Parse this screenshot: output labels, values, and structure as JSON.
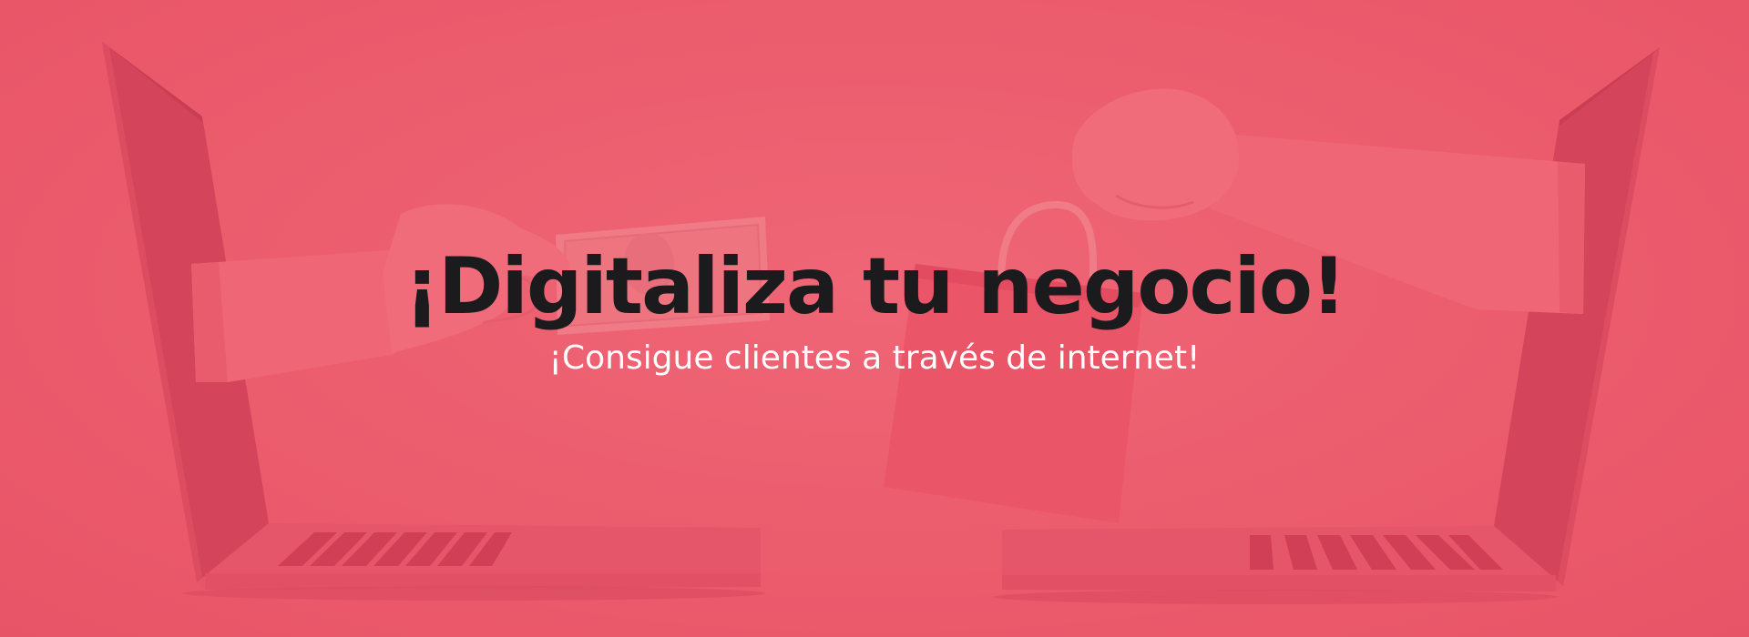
{
  "hero": {
    "title": "¡Digitaliza tu negocio!",
    "subtitle": "¡Consigue clientes a través de internet!"
  },
  "colors": {
    "background": "#ea5a6c",
    "title": "#1b1a1c",
    "subtitle": "#ffffff",
    "overlay_dark": "#d6455a"
  },
  "icons": {
    "left_visual": "laptop-icon",
    "right_visual": "laptop-icon",
    "hand_money": "hand-holding-money-icon",
    "hand_bag": "hand-holding-shopping-bag-icon"
  }
}
